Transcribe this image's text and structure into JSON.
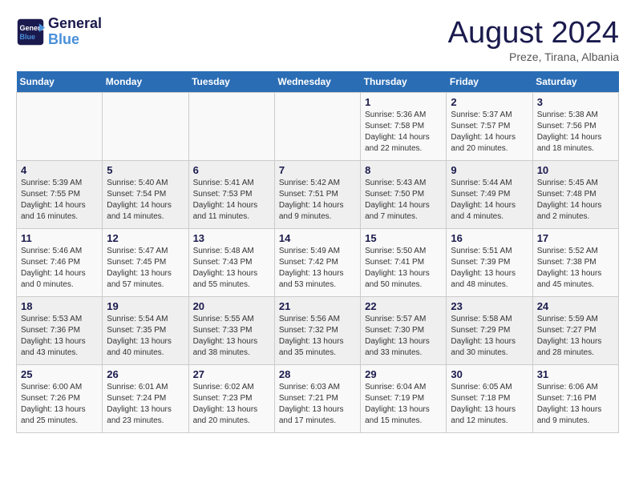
{
  "header": {
    "logo_line1": "General",
    "logo_line2": "Blue",
    "month": "August 2024",
    "location": "Preze, Tirana, Albania"
  },
  "days_of_week": [
    "Sunday",
    "Monday",
    "Tuesday",
    "Wednesday",
    "Thursday",
    "Friday",
    "Saturday"
  ],
  "weeks": [
    [
      {
        "day": "",
        "info": ""
      },
      {
        "day": "",
        "info": ""
      },
      {
        "day": "",
        "info": ""
      },
      {
        "day": "",
        "info": ""
      },
      {
        "day": "1",
        "info": "Sunrise: 5:36 AM\nSunset: 7:58 PM\nDaylight: 14 hours\nand 22 minutes."
      },
      {
        "day": "2",
        "info": "Sunrise: 5:37 AM\nSunset: 7:57 PM\nDaylight: 14 hours\nand 20 minutes."
      },
      {
        "day": "3",
        "info": "Sunrise: 5:38 AM\nSunset: 7:56 PM\nDaylight: 14 hours\nand 18 minutes."
      }
    ],
    [
      {
        "day": "4",
        "info": "Sunrise: 5:39 AM\nSunset: 7:55 PM\nDaylight: 14 hours\nand 16 minutes."
      },
      {
        "day": "5",
        "info": "Sunrise: 5:40 AM\nSunset: 7:54 PM\nDaylight: 14 hours\nand 14 minutes."
      },
      {
        "day": "6",
        "info": "Sunrise: 5:41 AM\nSunset: 7:53 PM\nDaylight: 14 hours\nand 11 minutes."
      },
      {
        "day": "7",
        "info": "Sunrise: 5:42 AM\nSunset: 7:51 PM\nDaylight: 14 hours\nand 9 minutes."
      },
      {
        "day": "8",
        "info": "Sunrise: 5:43 AM\nSunset: 7:50 PM\nDaylight: 14 hours\nand 7 minutes."
      },
      {
        "day": "9",
        "info": "Sunrise: 5:44 AM\nSunset: 7:49 PM\nDaylight: 14 hours\nand 4 minutes."
      },
      {
        "day": "10",
        "info": "Sunrise: 5:45 AM\nSunset: 7:48 PM\nDaylight: 14 hours\nand 2 minutes."
      }
    ],
    [
      {
        "day": "11",
        "info": "Sunrise: 5:46 AM\nSunset: 7:46 PM\nDaylight: 14 hours\nand 0 minutes."
      },
      {
        "day": "12",
        "info": "Sunrise: 5:47 AM\nSunset: 7:45 PM\nDaylight: 13 hours\nand 57 minutes."
      },
      {
        "day": "13",
        "info": "Sunrise: 5:48 AM\nSunset: 7:43 PM\nDaylight: 13 hours\nand 55 minutes."
      },
      {
        "day": "14",
        "info": "Sunrise: 5:49 AM\nSunset: 7:42 PM\nDaylight: 13 hours\nand 53 minutes."
      },
      {
        "day": "15",
        "info": "Sunrise: 5:50 AM\nSunset: 7:41 PM\nDaylight: 13 hours\nand 50 minutes."
      },
      {
        "day": "16",
        "info": "Sunrise: 5:51 AM\nSunset: 7:39 PM\nDaylight: 13 hours\nand 48 minutes."
      },
      {
        "day": "17",
        "info": "Sunrise: 5:52 AM\nSunset: 7:38 PM\nDaylight: 13 hours\nand 45 minutes."
      }
    ],
    [
      {
        "day": "18",
        "info": "Sunrise: 5:53 AM\nSunset: 7:36 PM\nDaylight: 13 hours\nand 43 minutes."
      },
      {
        "day": "19",
        "info": "Sunrise: 5:54 AM\nSunset: 7:35 PM\nDaylight: 13 hours\nand 40 minutes."
      },
      {
        "day": "20",
        "info": "Sunrise: 5:55 AM\nSunset: 7:33 PM\nDaylight: 13 hours\nand 38 minutes."
      },
      {
        "day": "21",
        "info": "Sunrise: 5:56 AM\nSunset: 7:32 PM\nDaylight: 13 hours\nand 35 minutes."
      },
      {
        "day": "22",
        "info": "Sunrise: 5:57 AM\nSunset: 7:30 PM\nDaylight: 13 hours\nand 33 minutes."
      },
      {
        "day": "23",
        "info": "Sunrise: 5:58 AM\nSunset: 7:29 PM\nDaylight: 13 hours\nand 30 minutes."
      },
      {
        "day": "24",
        "info": "Sunrise: 5:59 AM\nSunset: 7:27 PM\nDaylight: 13 hours\nand 28 minutes."
      }
    ],
    [
      {
        "day": "25",
        "info": "Sunrise: 6:00 AM\nSunset: 7:26 PM\nDaylight: 13 hours\nand 25 minutes."
      },
      {
        "day": "26",
        "info": "Sunrise: 6:01 AM\nSunset: 7:24 PM\nDaylight: 13 hours\nand 23 minutes."
      },
      {
        "day": "27",
        "info": "Sunrise: 6:02 AM\nSunset: 7:23 PM\nDaylight: 13 hours\nand 20 minutes."
      },
      {
        "day": "28",
        "info": "Sunrise: 6:03 AM\nSunset: 7:21 PM\nDaylight: 13 hours\nand 17 minutes."
      },
      {
        "day": "29",
        "info": "Sunrise: 6:04 AM\nSunset: 7:19 PM\nDaylight: 13 hours\nand 15 minutes."
      },
      {
        "day": "30",
        "info": "Sunrise: 6:05 AM\nSunset: 7:18 PM\nDaylight: 13 hours\nand 12 minutes."
      },
      {
        "day": "31",
        "info": "Sunrise: 6:06 AM\nSunset: 7:16 PM\nDaylight: 13 hours\nand 9 minutes."
      }
    ]
  ]
}
